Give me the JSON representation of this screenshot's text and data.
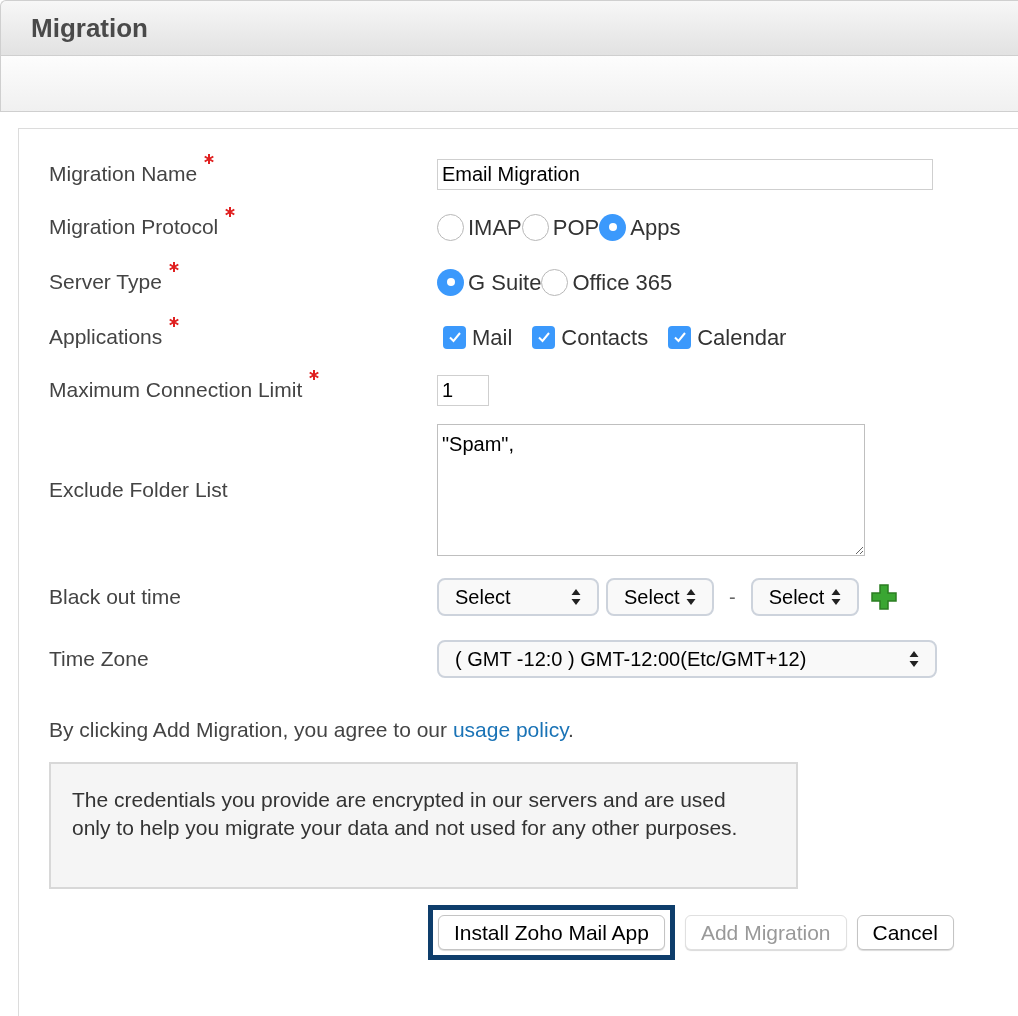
{
  "window": {
    "title": "Migration"
  },
  "fields": [
    {
      "kind": "text",
      "label": "Migration Name",
      "required": true,
      "value": "Email Migration"
    },
    {
      "kind": "radio",
      "label": "Migration Protocol",
      "required": true,
      "options": [
        {
          "label": "IMAP",
          "selected": false
        },
        {
          "label": "POP",
          "selected": false
        },
        {
          "label": "Apps",
          "selected": true
        }
      ]
    },
    {
      "kind": "radio",
      "label": "Server Type",
      "required": true,
      "options": [
        {
          "label": "G Suite",
          "selected": true
        },
        {
          "label": "Office 365",
          "selected": false
        }
      ]
    },
    {
      "kind": "checkbox",
      "label": "Applications",
      "required": true,
      "options": [
        {
          "label": "Mail",
          "checked": true
        },
        {
          "label": "Contacts",
          "checked": true
        },
        {
          "label": "Calendar",
          "checked": true
        }
      ]
    },
    {
      "kind": "number",
      "label": "Maximum Connection Limit",
      "required": true,
      "value": "1"
    },
    {
      "kind": "textarea",
      "label": "Exclude Folder List",
      "required": false,
      "value": "\"Spam\","
    },
    {
      "kind": "blackout",
      "label": "Black out time",
      "required": false,
      "selects": [
        "Select",
        "Select",
        "Select"
      ],
      "separator": "-"
    },
    {
      "kind": "select",
      "label": "Time Zone",
      "required": false,
      "value": "( GMT -12:0 ) GMT-12:00(Etc/GMT+12)"
    }
  ],
  "agreement": {
    "text": "By clicking Add Migration, you agree to our ",
    "link": "usage policy",
    "end": "."
  },
  "note": "The credentials you provide are encrypted in our servers and are used only to help you migrate your data and not used for any other purposes.",
  "buttons": [
    {
      "label": "Install Zoho Mail App",
      "disabled": false,
      "highlighted": true
    },
    {
      "label": "Add Migration",
      "disabled": true,
      "highlighted": false
    },
    {
      "label": "Cancel",
      "disabled": false,
      "highlighted": false
    }
  ]
}
